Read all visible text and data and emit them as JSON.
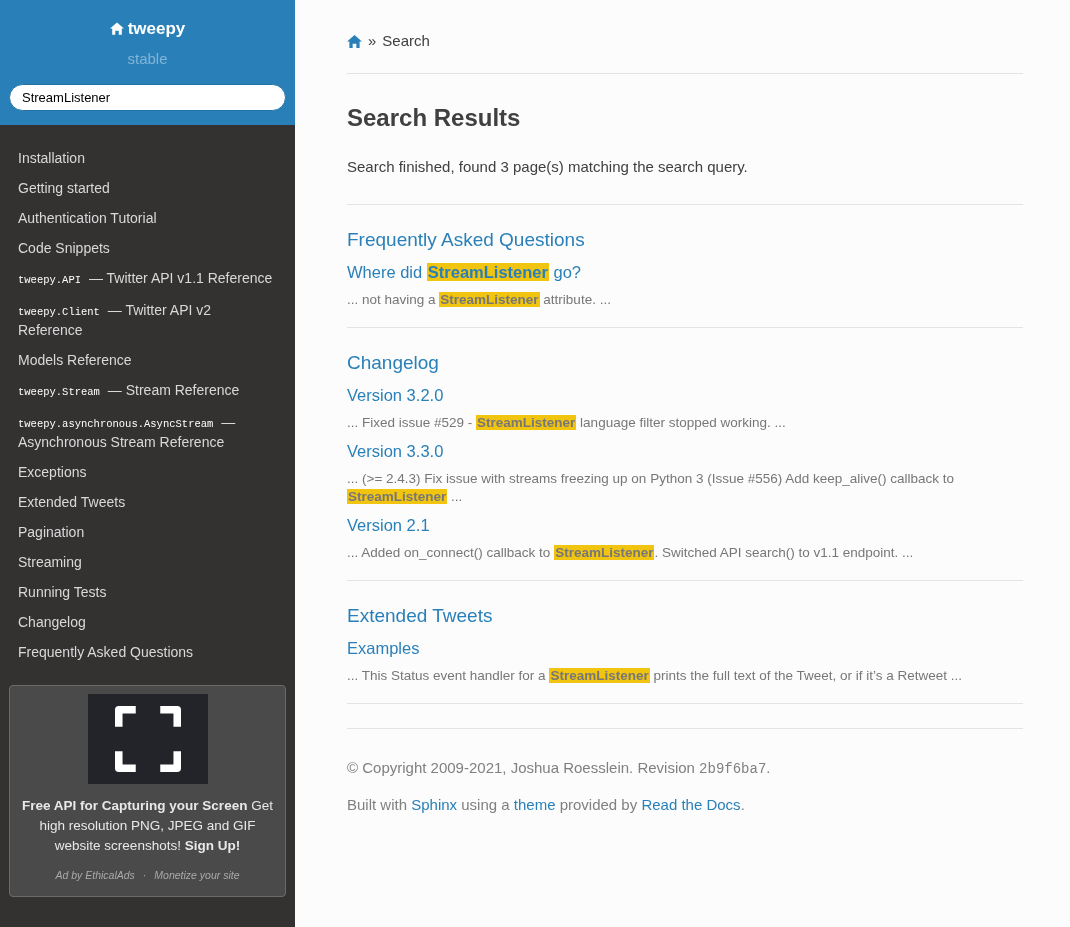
{
  "sidebar": {
    "project": "tweepy",
    "version": "stable",
    "search": {
      "value": "StreamListener"
    },
    "items": [
      {
        "label": "Installation"
      },
      {
        "label": "Getting started"
      },
      {
        "label": "Authentication Tutorial"
      },
      {
        "label": "Code Snippets"
      },
      {
        "code": "tweepy.API",
        "label": "— Twitter API v1.1 Reference"
      },
      {
        "code": "tweepy.Client",
        "label": "— Twitter API v2 Reference"
      },
      {
        "label": "Models Reference"
      },
      {
        "code": "tweepy.Stream",
        "label": "— Stream Reference"
      },
      {
        "code": "tweepy.asynchronous.AsyncStream",
        "label": "— Asynchronous Stream Reference"
      },
      {
        "label": "Exceptions"
      },
      {
        "label": "Extended Tweets"
      },
      {
        "label": "Pagination"
      },
      {
        "label": "Streaming"
      },
      {
        "label": "Running Tests"
      },
      {
        "label": "Changelog"
      },
      {
        "label": "Frequently Asked Questions"
      }
    ],
    "ad": {
      "text": "**Free API for Capturing your Screen** Get high resolution PNG, JPEG and GIF website screenshots! **Sign Up!**",
      "by": "Ad by EthicalAds",
      "separator": "·",
      "monetize": "Monetize your site"
    }
  },
  "breadcrumb": {
    "current": "Search",
    "separator": "»"
  },
  "title": "Search Results",
  "summary": "Search finished, found 3 page(s) matching the search query.",
  "results": [
    {
      "page": "Frequently Asked Questions",
      "hits": [
        {
          "title": [
            {
              "text": "Where did ",
              "highlight": false
            },
            {
              "text": "StreamListener",
              "highlight": true
            },
            {
              "text": " go?",
              "highlight": false
            }
          ],
          "snippet": [
            {
              "text": "... not having a ",
              "highlight": false
            },
            {
              "text": "StreamListener",
              "highlight": true
            },
            {
              "text": " attribute. ...",
              "highlight": false
            }
          ]
        }
      ]
    },
    {
      "page": "Changelog",
      "hits": [
        {
          "title": [
            {
              "text": "Version 3.2.0",
              "highlight": false
            }
          ],
          "snippet": [
            {
              "text": "... Fixed issue #529 - ",
              "highlight": false
            },
            {
              "text": "StreamListener",
              "highlight": true
            },
            {
              "text": " language filter stopped working. ...",
              "highlight": false
            }
          ]
        },
        {
          "title": [
            {
              "text": "Version 3.3.0",
              "highlight": false
            }
          ],
          "snippet": [
            {
              "text": "... (>= 2.4.3) Fix issue with streams freezing up on Python 3 (Issue #556) Add keep_alive() callback to ",
              "highlight": false
            },
            {
              "text": "StreamListener",
              "highlight": true
            },
            {
              "text": " ...",
              "highlight": false
            }
          ]
        },
        {
          "title": [
            {
              "text": "Version 2.1",
              "highlight": false
            }
          ],
          "snippet": [
            {
              "text": "... Added on_connect() callback to ",
              "highlight": false
            },
            {
              "text": "StreamListener",
              "highlight": true
            },
            {
              "text": ". Switched API search() to v1.1 endpoint. ...",
              "highlight": false
            }
          ]
        }
      ]
    },
    {
      "page": "Extended Tweets",
      "hits": [
        {
          "title": [
            {
              "text": "Examples",
              "highlight": false
            }
          ],
          "snippet": [
            {
              "text": "... This Status event handler for a ",
              "highlight": false
            },
            {
              "text": "StreamListener",
              "highlight": true
            },
            {
              "text": " prints the full text of the Tweet, or if it’s a Retweet ...",
              "highlight": false
            }
          ]
        }
      ]
    }
  ],
  "footer": {
    "lines": [
      [
        {
          "kind": "text",
          "text": "© Copyright 2009-2021, Joshua Roesslein. Revision "
        },
        {
          "kind": "code",
          "text": "2b9f6ba7"
        },
        {
          "kind": "text",
          "text": "."
        }
      ],
      [
        {
          "kind": "text",
          "text": "Built with "
        },
        {
          "kind": "link",
          "text": "Sphinx"
        },
        {
          "kind": "text",
          "text": " using a "
        },
        {
          "kind": "link",
          "text": "theme"
        },
        {
          "kind": "text",
          "text": " provided by "
        },
        {
          "kind": "link",
          "text": "Read the Docs"
        },
        {
          "kind": "text",
          "text": "."
        }
      ]
    ]
  }
}
